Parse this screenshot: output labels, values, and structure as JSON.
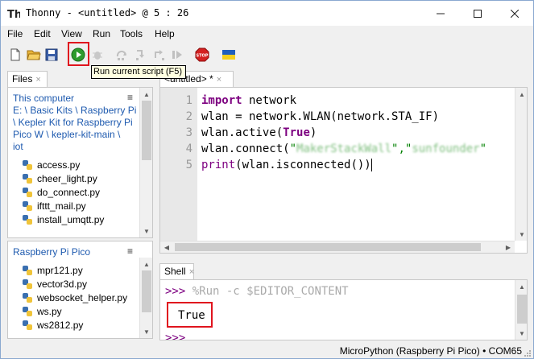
{
  "window": {
    "title": "Thonny - <untitled> @ 5 : 26"
  },
  "menu": [
    "File",
    "Edit",
    "View",
    "Run",
    "Tools",
    "Help"
  ],
  "toolbar": {
    "tooltip": "Run current script (F5)",
    "icons": [
      "new-file-icon",
      "open-folder-icon",
      "save-icon",
      "run-icon",
      "debug-icon",
      "step-over-icon",
      "step-into-icon",
      "step-out-icon",
      "resume-icon",
      "stop-icon",
      "ukraine-flag-icon"
    ],
    "run_color": "#2e9b2e",
    "stop_color": "#d42020",
    "highlight_color": "#e0141e"
  },
  "files": {
    "tab_label": "Files",
    "tab_close": "×",
    "computer": {
      "header": "This computer",
      "menu_glyph": "≡",
      "path_lines": [
        "E: \\ Basic Kits \\ Raspberry Pi",
        "\\ Kepler Kit for Raspberry Pi",
        "Pico W \\ kepler-kit-main \\",
        "iot"
      ],
      "items": [
        "access.py",
        "cheer_light.py",
        "do_connect.py",
        "ifttt_mail.py",
        "install_umqtt.py"
      ]
    },
    "pico": {
      "header": "Raspberry Pi Pico",
      "menu_glyph": "≡",
      "items": [
        "mpr121.py",
        "vector3d.py",
        "websocket_helper.py",
        "ws.py",
        "ws2812.py"
      ]
    }
  },
  "editor": {
    "tab_label": "<untitled> *",
    "tab_close": "×",
    "line_numbers": [
      "1",
      "2",
      "3",
      "4",
      "5"
    ],
    "code": {
      "l1_kw": "import",
      "l1_rest": " network",
      "l2_a": "wlan = network.WLAN(network.STA_IF)",
      "l3_a": "wlan.active(",
      "l3_kw": "True",
      "l3_b": ")",
      "l4_a": "wlan.connect(",
      "l4_q1": "\"",
      "l4_ssid": "MakerStackWall",
      "l4_q2": "\",\"",
      "l4_pwd": "sunfounder",
      "l4_q3": "\"",
      "l5_fn": "print",
      "l5_rest": "(wlan.isconnected())"
    }
  },
  "shell": {
    "tab_label": "Shell",
    "tab_close": "×",
    "prompt": ">>>",
    "command": " %Run -c $EDITOR_CONTENT",
    "output": "True",
    "next_prompt": ">>>"
  },
  "status": {
    "text": "MicroPython (Raspberry Pi Pico)  •  COM65"
  }
}
